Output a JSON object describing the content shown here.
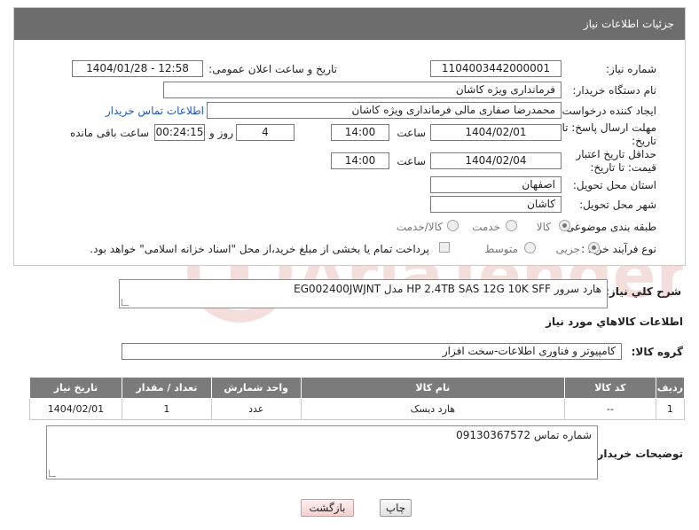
{
  "header": {
    "title": "جزئیات اطلاعات نیاز"
  },
  "form": {
    "need_number_label": "شماره نیاز:",
    "need_number": "1104003442000001",
    "announce_label": "تاریخ و ساعت اعلان عمومی:",
    "announce_value": "1404/01/28 - 12:58",
    "buyer_org_label": "نام دستگاه خریدار:",
    "buyer_org": "فرمانداری ویژه کاشان",
    "creator_label": "ایجاد کننده درخواست:",
    "creator": "محمدرضا صفاری مالی فرمانداری ویژه کاشان",
    "contact_link": "اطلاعات تماس خریدار",
    "deadline_label": "مهلت ارسال پاسخ: تا تاریخ:",
    "deadline_date": "1404/02/01",
    "time_label": "ساعت",
    "deadline_time": "14:00",
    "days_value": "4",
    "days_label": "روز و",
    "remaining_time": "00:24:15",
    "remaining_label": "ساعت باقی مانده",
    "price_validity_label": "حداقل تاریخ اعتبار قیمت: تا تاریخ:",
    "price_date": "1404/02/04",
    "price_time": "14:00",
    "province_label": "استان محل تحویل:",
    "province": "اصفهان",
    "city_label": "شهر محل تحویل:",
    "city": "کاشان",
    "category_label": "طبقه بندی موضوعی:",
    "category_options": [
      "کالا",
      "خدمت",
      "کالا/خدمت"
    ],
    "process_label": "نوع فرآیند خرید :",
    "process_options": [
      "جزیی",
      "متوسط"
    ],
    "payment_note": "پرداخت تمام یا بخشی از مبلغ خرید،از محل \"اسناد خزانه اسلامی\" خواهد بود."
  },
  "description": {
    "label": "شرح کلي نياز:",
    "text": "هارد سرور HP 2.4TB SAS 12G 10K SFF مدل EG002400JWJNT"
  },
  "goods_section": {
    "title": "اطلاعات كالاهاي مورد نياز",
    "group_label": "گروه كالا:",
    "group_value": "کامپیوتر و فناوری اطلاعات-سخت افزار"
  },
  "table": {
    "headers": [
      "ردیف",
      "کد کالا",
      "نام کالا",
      "واحد شمارش",
      "تعداد / مقدار",
      "تاریخ نیاز"
    ],
    "rows": [
      [
        "1",
        "--",
        "هارد دیسک",
        "عدد",
        "1",
        "1404/02/01"
      ]
    ]
  },
  "buyer_notes": {
    "label": "توضیحات خریدار:",
    "text": "شماره تماس 09130367572"
  },
  "buttons": {
    "print": "چاپ",
    "back": "بازگشت"
  },
  "watermark": {
    "text": "AriaTender.neT"
  }
}
